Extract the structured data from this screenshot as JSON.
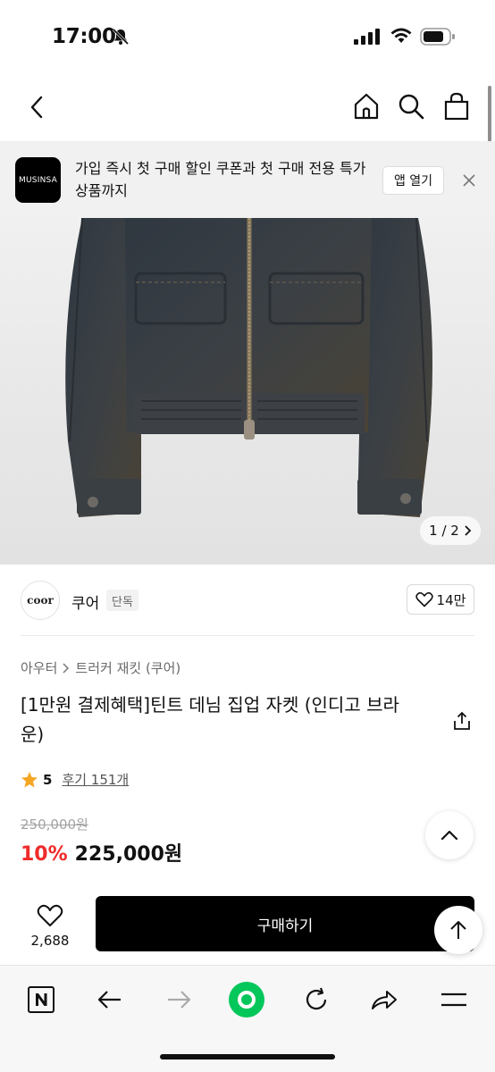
{
  "status_bar": {
    "time": "17:00",
    "icons": [
      "bell-off-icon",
      "signal-icon",
      "wifi-icon",
      "battery-icon"
    ]
  },
  "header": {
    "icons": [
      "back-arrow-icon",
      "home-icon",
      "search-icon",
      "shopping-bag-icon"
    ]
  },
  "promo_banner": {
    "logo_text": "MUSINSA",
    "text": "가입 즉시 첫 구매 할인 쿠폰과 첫 구매 전용 특가 상품까지",
    "open_app_label": "앱 열기"
  },
  "product_image": {
    "counter_current": "1",
    "counter_total": "2",
    "counter_text": "1 / 2"
  },
  "brand": {
    "logo_text": "coor",
    "name": "쿠어",
    "badge": "단독",
    "likes": "14만"
  },
  "product": {
    "breadcrumb": [
      "아우터",
      "트러커 재킷 (쿠어)"
    ],
    "title": "[1만원 결제혜택]틴트 데님 집업 자켓 (인디고 브라운)",
    "rating": "5",
    "reviews": "후기 151개",
    "original_price": "250,000원",
    "discount_rate": "10%",
    "sale_price": "225,000원"
  },
  "purchase_bar": {
    "wish_count": "2,688",
    "buy_label": "구매하기"
  },
  "browser_toolbar": {
    "icons": [
      "naver-n-icon",
      "back-icon",
      "forward-icon",
      "green-circle-icon",
      "reload-icon",
      "share-icon",
      "menu-icon"
    ]
  },
  "colors": {
    "accent_red": "#ef2b2b",
    "star": "#f5a623",
    "naver_green": "#03c75a",
    "black": "#000000"
  }
}
